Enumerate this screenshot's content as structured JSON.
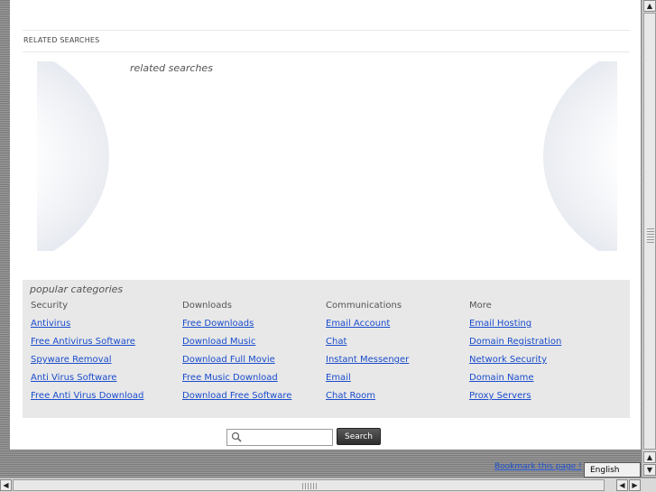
{
  "related": {
    "heading": "RELATED SEARCHES",
    "subheading": "related searches"
  },
  "popular": {
    "title": "popular categories",
    "columns": [
      {
        "header": "Security",
        "links": [
          "Antivirus",
          "Free Antivirus Software",
          "Spyware Removal",
          "Anti Virus Software",
          "Free Anti Virus Download"
        ]
      },
      {
        "header": "Downloads",
        "links": [
          "Free Downloads",
          "Download Music",
          "Download Full Movie",
          "Free Music Download",
          "Download Free Software"
        ]
      },
      {
        "header": "Communications",
        "links": [
          "Email Account",
          "Chat",
          "Instant Messenger",
          "Email",
          "Chat Room"
        ]
      },
      {
        "header": "More",
        "links": [
          "Email Hosting",
          "Domain Registration",
          "Network Security",
          "Domain Name",
          "Proxy Servers"
        ]
      }
    ]
  },
  "search": {
    "input_value": "",
    "button_label": "Search",
    "icon": "magnifier-icon"
  },
  "footer": {
    "bookmark_link": "Bookmark this page !",
    "language": "English"
  },
  "scrollbars": {
    "up_glyph": "▲",
    "down_glyph": "▼",
    "left_glyph": "◀",
    "right_glyph": "▶"
  },
  "colors": {
    "link": "#1a4ccc",
    "popular_bg": "#e8e8e8",
    "button_bg": "#3a3a3a"
  }
}
